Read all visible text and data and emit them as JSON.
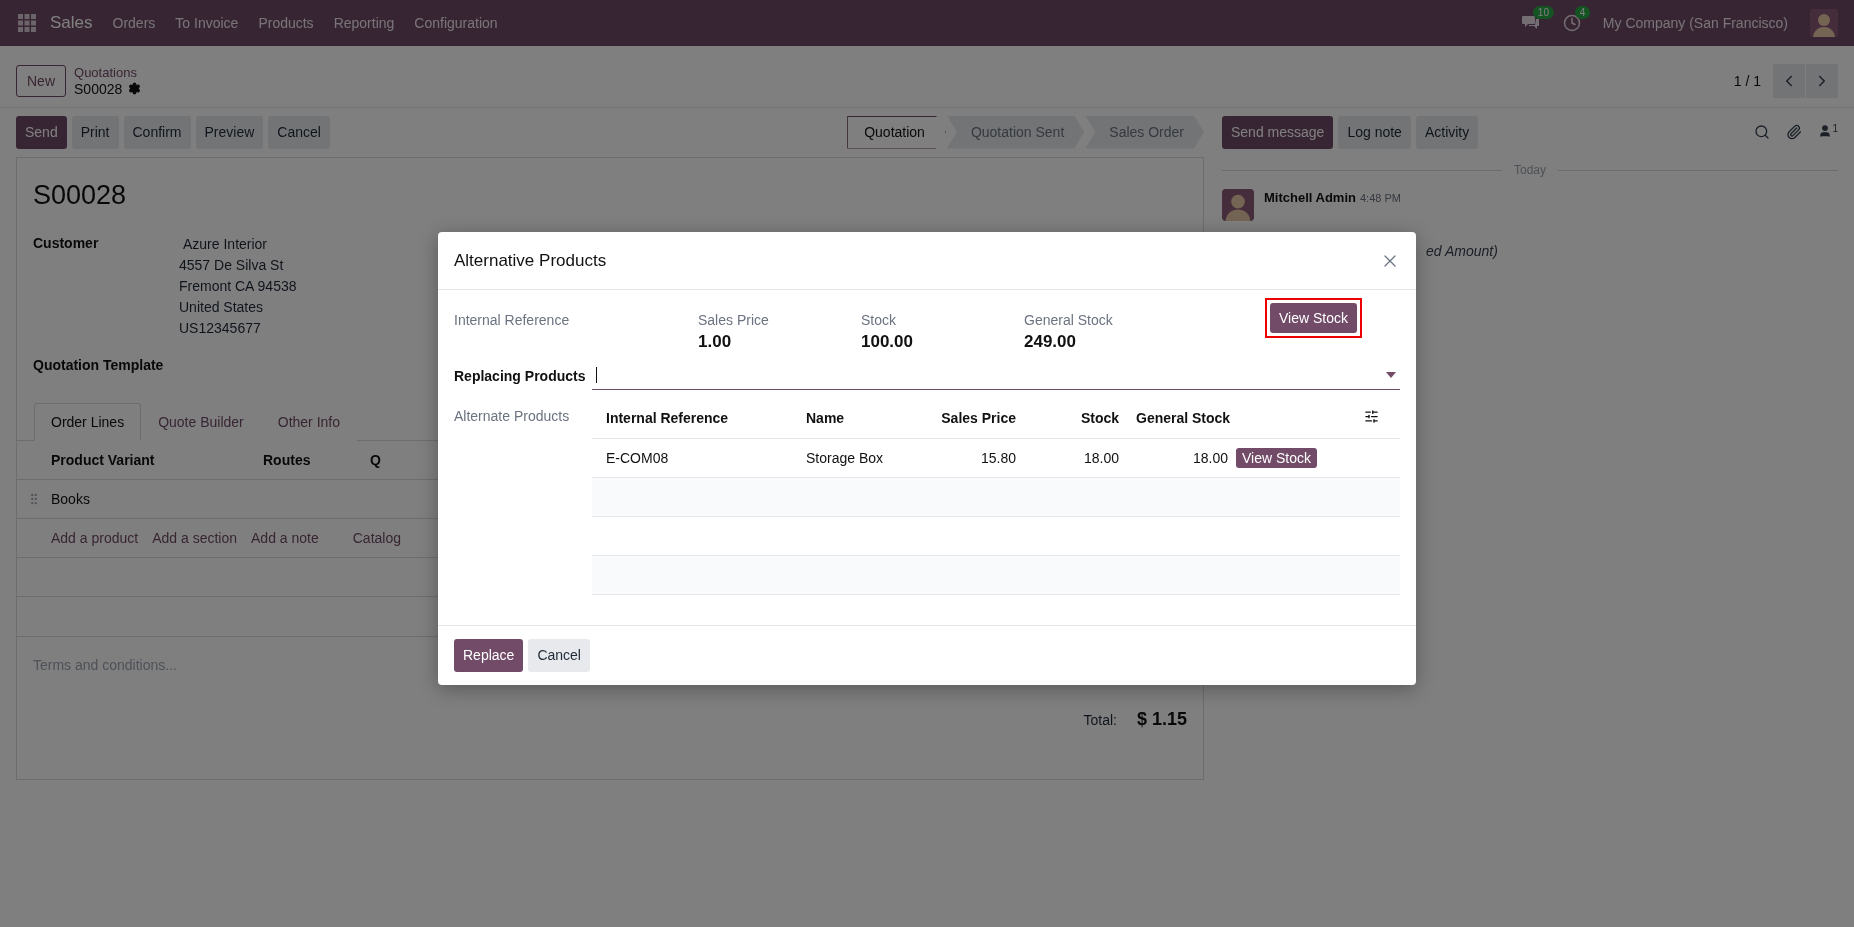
{
  "navbar": {
    "app_name": "Sales",
    "menu": [
      "Orders",
      "To Invoice",
      "Products",
      "Reporting",
      "Configuration"
    ],
    "messages_count": "10",
    "activities_count": "4",
    "company": "My Company (San Francisco)"
  },
  "control_panel": {
    "new_button": "New",
    "breadcrumb": "Quotations",
    "record": "S00028",
    "pager": "1 / 1"
  },
  "action_buttons": [
    {
      "label": "Send",
      "primary": true
    },
    {
      "label": "Print",
      "primary": false
    },
    {
      "label": "Confirm",
      "primary": false
    },
    {
      "label": "Preview",
      "primary": false
    },
    {
      "label": "Cancel",
      "primary": false
    }
  ],
  "statusbar": [
    {
      "label": "Quotation",
      "selected": true
    },
    {
      "label": "Quotation Sent",
      "selected": false
    },
    {
      "label": "Sales Order",
      "selected": false
    }
  ],
  "chatter": {
    "buttons": [
      {
        "label": "Send message",
        "primary": true
      },
      {
        "label": "Log note",
        "primary": false
      },
      {
        "label": "Activity",
        "primary": false
      }
    ],
    "followers_count": "1",
    "date_separator": "Today",
    "message": {
      "author": "Mitchell Admin",
      "time": "4:48 PM",
      "text": "ed Amount)"
    }
  },
  "form": {
    "title": "S00028",
    "customer_label": "Customer",
    "customer_lines": [
      "Azure Interior",
      "4557 De Silva St",
      "Fremont CA 94538",
      "United States",
      "US12345677"
    ],
    "template_label": "Quotation Template",
    "tabs": [
      {
        "label": "Order Lines",
        "selected": true
      },
      {
        "label": "Quote Builder",
        "selected": false
      },
      {
        "label": "Other Info",
        "selected": false
      }
    ],
    "columns": [
      "Product Variant",
      "Routes",
      "Q"
    ],
    "rows": [
      {
        "product": "Books"
      }
    ],
    "add_links": [
      "Add a product",
      "Add a section",
      "Add a note",
      "Catalog"
    ],
    "terms_placeholder": "Terms and conditions...",
    "total_label": "Total:",
    "total_value": "$ 1.15"
  },
  "dialog": {
    "title": "Alternative Products",
    "summary": {
      "reference_label": "Internal Reference",
      "fields": [
        {
          "label": "Sales Price",
          "value": "1.00"
        },
        {
          "label": "Stock",
          "value": "100.00"
        },
        {
          "label": "General Stock",
          "value": "249.00"
        }
      ],
      "button": "View Stock",
      "highlighted": true
    },
    "replacing_label": "Replacing Products",
    "alternate_label": "Alternate Products",
    "columns": [
      "Internal Reference",
      "Name",
      "Sales Price",
      "Stock",
      "General Stock"
    ],
    "rows": [
      {
        "cells": [
          "E-COM08",
          "Storage Box",
          "15.80",
          "18.00",
          "18.00"
        ],
        "button": "View Stock"
      }
    ],
    "footer_buttons": [
      {
        "label": "Replace",
        "primary": true
      },
      {
        "label": "Cancel",
        "primary": false
      }
    ]
  }
}
